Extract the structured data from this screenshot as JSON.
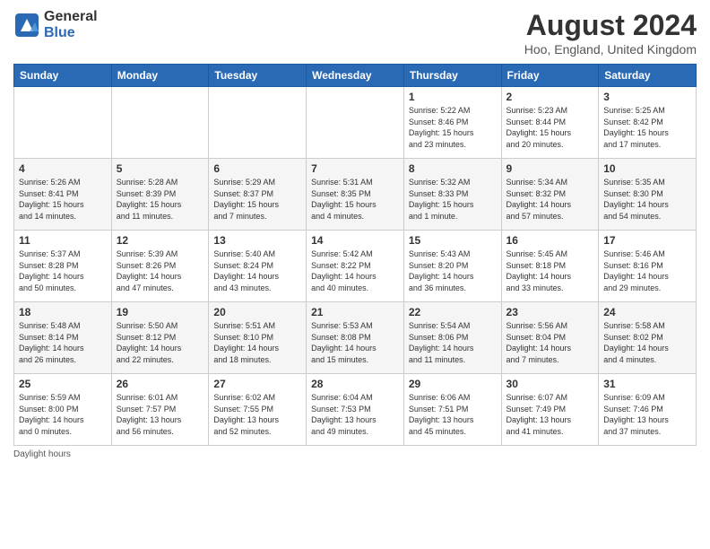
{
  "logo": {
    "general": "General",
    "blue": "Blue"
  },
  "title": "August 2024",
  "location": "Hoo, England, United Kingdom",
  "headers": [
    "Sunday",
    "Monday",
    "Tuesday",
    "Wednesday",
    "Thursday",
    "Friday",
    "Saturday"
  ],
  "footer": "Daylight hours",
  "weeks": [
    [
      {
        "day": "",
        "info": ""
      },
      {
        "day": "",
        "info": ""
      },
      {
        "day": "",
        "info": ""
      },
      {
        "day": "",
        "info": ""
      },
      {
        "day": "1",
        "info": "Sunrise: 5:22 AM\nSunset: 8:46 PM\nDaylight: 15 hours\nand 23 minutes."
      },
      {
        "day": "2",
        "info": "Sunrise: 5:23 AM\nSunset: 8:44 PM\nDaylight: 15 hours\nand 20 minutes."
      },
      {
        "day": "3",
        "info": "Sunrise: 5:25 AM\nSunset: 8:42 PM\nDaylight: 15 hours\nand 17 minutes."
      }
    ],
    [
      {
        "day": "4",
        "info": "Sunrise: 5:26 AM\nSunset: 8:41 PM\nDaylight: 15 hours\nand 14 minutes."
      },
      {
        "day": "5",
        "info": "Sunrise: 5:28 AM\nSunset: 8:39 PM\nDaylight: 15 hours\nand 11 minutes."
      },
      {
        "day": "6",
        "info": "Sunrise: 5:29 AM\nSunset: 8:37 PM\nDaylight: 15 hours\nand 7 minutes."
      },
      {
        "day": "7",
        "info": "Sunrise: 5:31 AM\nSunset: 8:35 PM\nDaylight: 15 hours\nand 4 minutes."
      },
      {
        "day": "8",
        "info": "Sunrise: 5:32 AM\nSunset: 8:33 PM\nDaylight: 15 hours\nand 1 minute."
      },
      {
        "day": "9",
        "info": "Sunrise: 5:34 AM\nSunset: 8:32 PM\nDaylight: 14 hours\nand 57 minutes."
      },
      {
        "day": "10",
        "info": "Sunrise: 5:35 AM\nSunset: 8:30 PM\nDaylight: 14 hours\nand 54 minutes."
      }
    ],
    [
      {
        "day": "11",
        "info": "Sunrise: 5:37 AM\nSunset: 8:28 PM\nDaylight: 14 hours\nand 50 minutes."
      },
      {
        "day": "12",
        "info": "Sunrise: 5:39 AM\nSunset: 8:26 PM\nDaylight: 14 hours\nand 47 minutes."
      },
      {
        "day": "13",
        "info": "Sunrise: 5:40 AM\nSunset: 8:24 PM\nDaylight: 14 hours\nand 43 minutes."
      },
      {
        "day": "14",
        "info": "Sunrise: 5:42 AM\nSunset: 8:22 PM\nDaylight: 14 hours\nand 40 minutes."
      },
      {
        "day": "15",
        "info": "Sunrise: 5:43 AM\nSunset: 8:20 PM\nDaylight: 14 hours\nand 36 minutes."
      },
      {
        "day": "16",
        "info": "Sunrise: 5:45 AM\nSunset: 8:18 PM\nDaylight: 14 hours\nand 33 minutes."
      },
      {
        "day": "17",
        "info": "Sunrise: 5:46 AM\nSunset: 8:16 PM\nDaylight: 14 hours\nand 29 minutes."
      }
    ],
    [
      {
        "day": "18",
        "info": "Sunrise: 5:48 AM\nSunset: 8:14 PM\nDaylight: 14 hours\nand 26 minutes."
      },
      {
        "day": "19",
        "info": "Sunrise: 5:50 AM\nSunset: 8:12 PM\nDaylight: 14 hours\nand 22 minutes."
      },
      {
        "day": "20",
        "info": "Sunrise: 5:51 AM\nSunset: 8:10 PM\nDaylight: 14 hours\nand 18 minutes."
      },
      {
        "day": "21",
        "info": "Sunrise: 5:53 AM\nSunset: 8:08 PM\nDaylight: 14 hours\nand 15 minutes."
      },
      {
        "day": "22",
        "info": "Sunrise: 5:54 AM\nSunset: 8:06 PM\nDaylight: 14 hours\nand 11 minutes."
      },
      {
        "day": "23",
        "info": "Sunrise: 5:56 AM\nSunset: 8:04 PM\nDaylight: 14 hours\nand 7 minutes."
      },
      {
        "day": "24",
        "info": "Sunrise: 5:58 AM\nSunset: 8:02 PM\nDaylight: 14 hours\nand 4 minutes."
      }
    ],
    [
      {
        "day": "25",
        "info": "Sunrise: 5:59 AM\nSunset: 8:00 PM\nDaylight: 14 hours\nand 0 minutes."
      },
      {
        "day": "26",
        "info": "Sunrise: 6:01 AM\nSunset: 7:57 PM\nDaylight: 13 hours\nand 56 minutes."
      },
      {
        "day": "27",
        "info": "Sunrise: 6:02 AM\nSunset: 7:55 PM\nDaylight: 13 hours\nand 52 minutes."
      },
      {
        "day": "28",
        "info": "Sunrise: 6:04 AM\nSunset: 7:53 PM\nDaylight: 13 hours\nand 49 minutes."
      },
      {
        "day": "29",
        "info": "Sunrise: 6:06 AM\nSunset: 7:51 PM\nDaylight: 13 hours\nand 45 minutes."
      },
      {
        "day": "30",
        "info": "Sunrise: 6:07 AM\nSunset: 7:49 PM\nDaylight: 13 hours\nand 41 minutes."
      },
      {
        "day": "31",
        "info": "Sunrise: 6:09 AM\nSunset: 7:46 PM\nDaylight: 13 hours\nand 37 minutes."
      }
    ]
  ]
}
